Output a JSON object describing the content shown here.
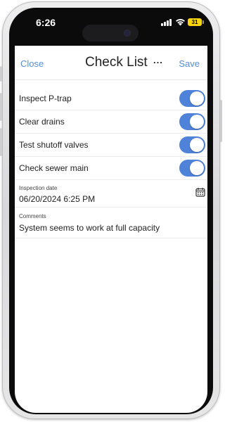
{
  "status_bar": {
    "time": "6:26",
    "battery": "31"
  },
  "nav": {
    "close_label": "Close",
    "title": "Check List",
    "more_label": "...",
    "save_label": "Save"
  },
  "checklist": [
    {
      "label": "Inspect P-trap",
      "checked": true
    },
    {
      "label": "Clear drains",
      "checked": true
    },
    {
      "label": "Test shutoff valves",
      "checked": true
    },
    {
      "label": "Check sewer main",
      "checked": true
    }
  ],
  "inspection_date": {
    "label": "Inspection date",
    "value": "06/20/2024 6:25 PM"
  },
  "comments": {
    "label": "Comments",
    "value": "System seems to work at full capacity"
  },
  "colors": {
    "accent": "#4f82d9",
    "link": "#5b8fd6",
    "battery": "#ffd60a"
  }
}
